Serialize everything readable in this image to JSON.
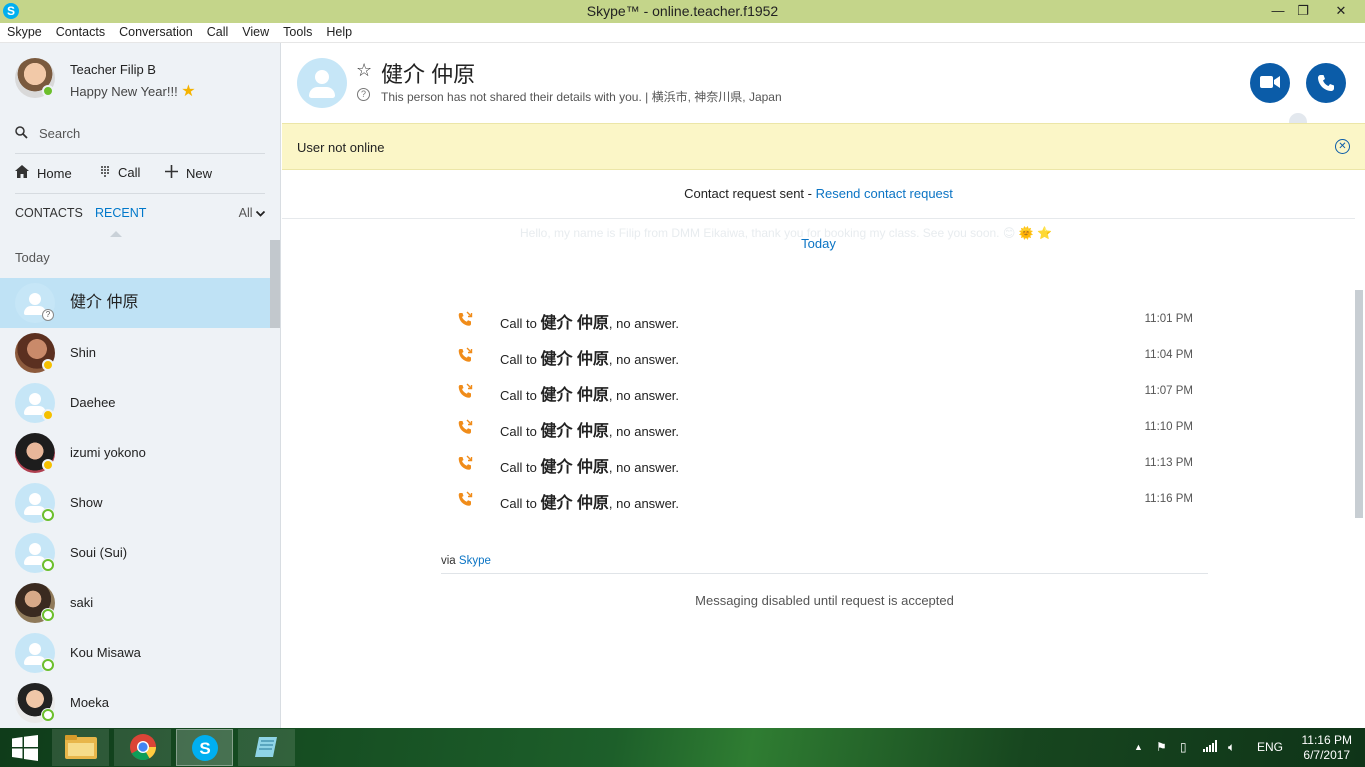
{
  "window": {
    "title": "Skype™ - online.teacher.f1952",
    "app_icon": "S",
    "minimize": "—",
    "restore": "❐",
    "close": "✕"
  },
  "menu": [
    "Skype",
    "Contacts",
    "Conversation",
    "Call",
    "View",
    "Tools",
    "Help"
  ],
  "profile": {
    "name": "Teacher Filip B",
    "mood": "Happy New Year!!! "
  },
  "search": {
    "placeholder": "Search"
  },
  "nav": {
    "home": "Home",
    "call": "Call",
    "new": "New"
  },
  "tabs": {
    "contacts": "CONTACTS",
    "recent": "RECENT",
    "filter": "All"
  },
  "recent": {
    "group": "Today",
    "items": [
      {
        "name": "健介 仲原",
        "status": "unknown",
        "selected": true
      },
      {
        "name": "Shin",
        "status": "away"
      },
      {
        "name": "Daehee",
        "status": "away"
      },
      {
        "name": "izumi yokono",
        "status": "away"
      },
      {
        "name": "Show",
        "status": "online"
      },
      {
        "name": "Soui (Sui)",
        "status": "online"
      },
      {
        "name": "saki",
        "status": "online"
      },
      {
        "name": "Kou Misawa",
        "status": "online"
      },
      {
        "name": "Moeka",
        "status": "online"
      }
    ]
  },
  "conversation": {
    "name": "健介 仲原",
    "info_text": "This person has not shared their details with you.",
    "location": "横浜市, 神奈川県, Japan",
    "banner": "User not online",
    "request_text": "Contact request sent - ",
    "resend_link": "Resend contact request",
    "ghost_message": "Hello, my name is Filip from DMM Eikaiwa, thank you for booking my class. See you soon. 😊 🌞 ⭐",
    "date_separator": "Today",
    "call_prefix": "Call to ",
    "call_suffix": ", no answer.",
    "calls": [
      {
        "time": "11:01 PM"
      },
      {
        "time": "11:04 PM"
      },
      {
        "time": "11:07 PM"
      },
      {
        "time": "11:10 PM"
      },
      {
        "time": "11:13 PM"
      },
      {
        "time": "11:16 PM"
      }
    ],
    "via_prefix": "via ",
    "via_link": "Skype",
    "disabled_message": "Messaging disabled until request is accepted"
  },
  "taskbar": {
    "language": "ENG",
    "time": "11:16 PM",
    "date": "6/7/2017"
  },
  "colors": {
    "accent": "#0b5ca8",
    "link": "#0b74c4",
    "title_bar": "#c4d58a",
    "banner": "#fbf6c7",
    "selected_row": "#bfe2f5",
    "missed_call": "#f08c1a"
  }
}
